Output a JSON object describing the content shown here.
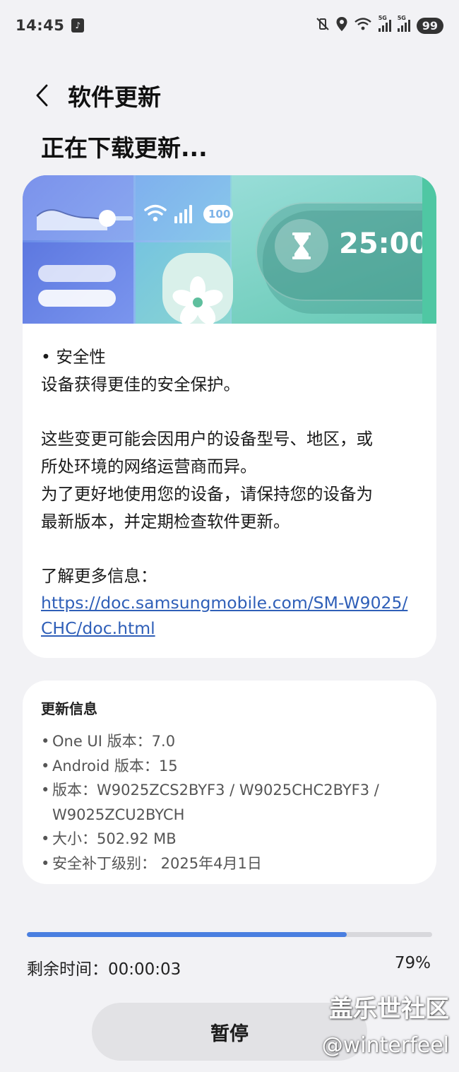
{
  "status_bar": {
    "time": "14:45",
    "battery": "99",
    "net_label_1": "5G",
    "net_label_2": "5G"
  },
  "header": {
    "title": "软件更新"
  },
  "status_heading": "正在下载更新...",
  "banner": {
    "timer": "25:00",
    "battery_pill": "100"
  },
  "notes": {
    "bullet_title": "• 安全性",
    "line1": "设备获得更佳的安全保护。",
    "para2_l1": "这些变更可能会因用户的设备型号、地区，或",
    "para2_l2": "所处环境的网络运营商而异。",
    "para2_l3": "为了更好地使用您的设备，请保持您的设备为",
    "para2_l4": "最新版本，并定期检查软件更新。",
    "more_info": "了解更多信息：",
    "link": "https://doc.samsungmobile.com/SM-W9025/CHC/doc.html"
  },
  "update_info": {
    "title": "更新信息",
    "rows": [
      {
        "bullet": "•",
        "text": "One UI 版本：7.0"
      },
      {
        "bullet": "•",
        "text": "Android 版本：15"
      },
      {
        "bullet": "•",
        "text": "版本：W9025ZCS2BYF3 / W9025CHC2BYF3 / W9025ZCU2BYCH"
      },
      {
        "bullet": "•",
        "text": "大小：502.92 MB"
      },
      {
        "bullet": "•",
        "text": "安全补丁级别： 2025年4月1日"
      }
    ]
  },
  "progress": {
    "fraction": 0.79,
    "remaining": "剩余时间：00:00:03",
    "percent": "79%"
  },
  "pause_label": "暂停",
  "watermark": {
    "line1": "盖乐世社区",
    "line2": "@winterfeel"
  },
  "colors": {
    "accent": "#4a7fe0",
    "link": "#2f5fb8",
    "background": "#f2f2f5"
  }
}
